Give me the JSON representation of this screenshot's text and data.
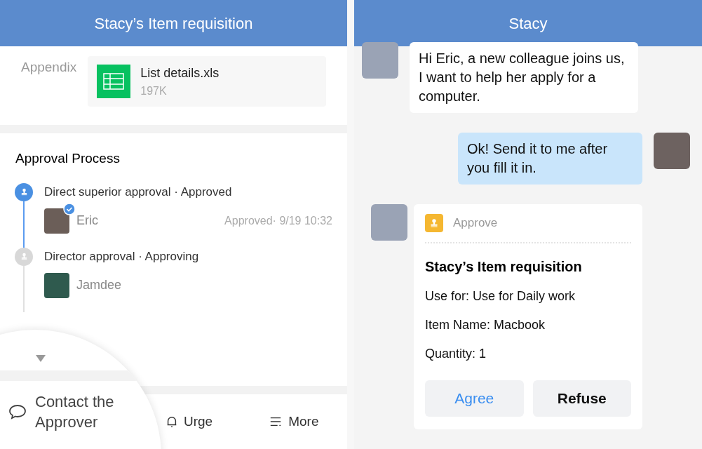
{
  "left_screen": {
    "title": "Stacy’s Item requisition",
    "appendix": {
      "label": "Appendix",
      "file_name": "List details.xls",
      "file_size": "197K"
    },
    "approval_process": {
      "heading": "Approval Process",
      "steps": [
        {
          "title": "Direct superior approval · Approved",
          "completed": true,
          "approver": "Eric",
          "approved": true,
          "result": "Approved· 9/19 10:32"
        },
        {
          "title": "Director approval · Approving",
          "completed": false,
          "approver": "Jamdee",
          "approved": false
        }
      ]
    },
    "bottom_bar": [
      {
        "kind": "urge",
        "label": "Urge"
      },
      {
        "kind": "more",
        "label": "More"
      }
    ],
    "magnifier": {
      "label": "Contact the Approver"
    }
  },
  "right_screen": {
    "title": "Stacy",
    "messages": [
      {
        "kind": "text",
        "outgoing": false,
        "text": "Hi Eric, a new colleague joins us, I want to help her apply for a computer."
      },
      {
        "kind": "text",
        "outgoing": true,
        "text": "Ok! Send it to me after you fill it in."
      },
      {
        "kind": "card",
        "outgoing": false,
        "card_type": "Approve",
        "title": "Stacy’s Item requisition",
        "lines": [
          "Use for: Use for Daily work",
          "Item Name: Macbook",
          "Quantity: 1"
        ],
        "buttons": [
          {
            "label": "Agree",
            "primary": true
          },
          {
            "label": "Refuse",
            "primary": false
          }
        ]
      }
    ]
  }
}
